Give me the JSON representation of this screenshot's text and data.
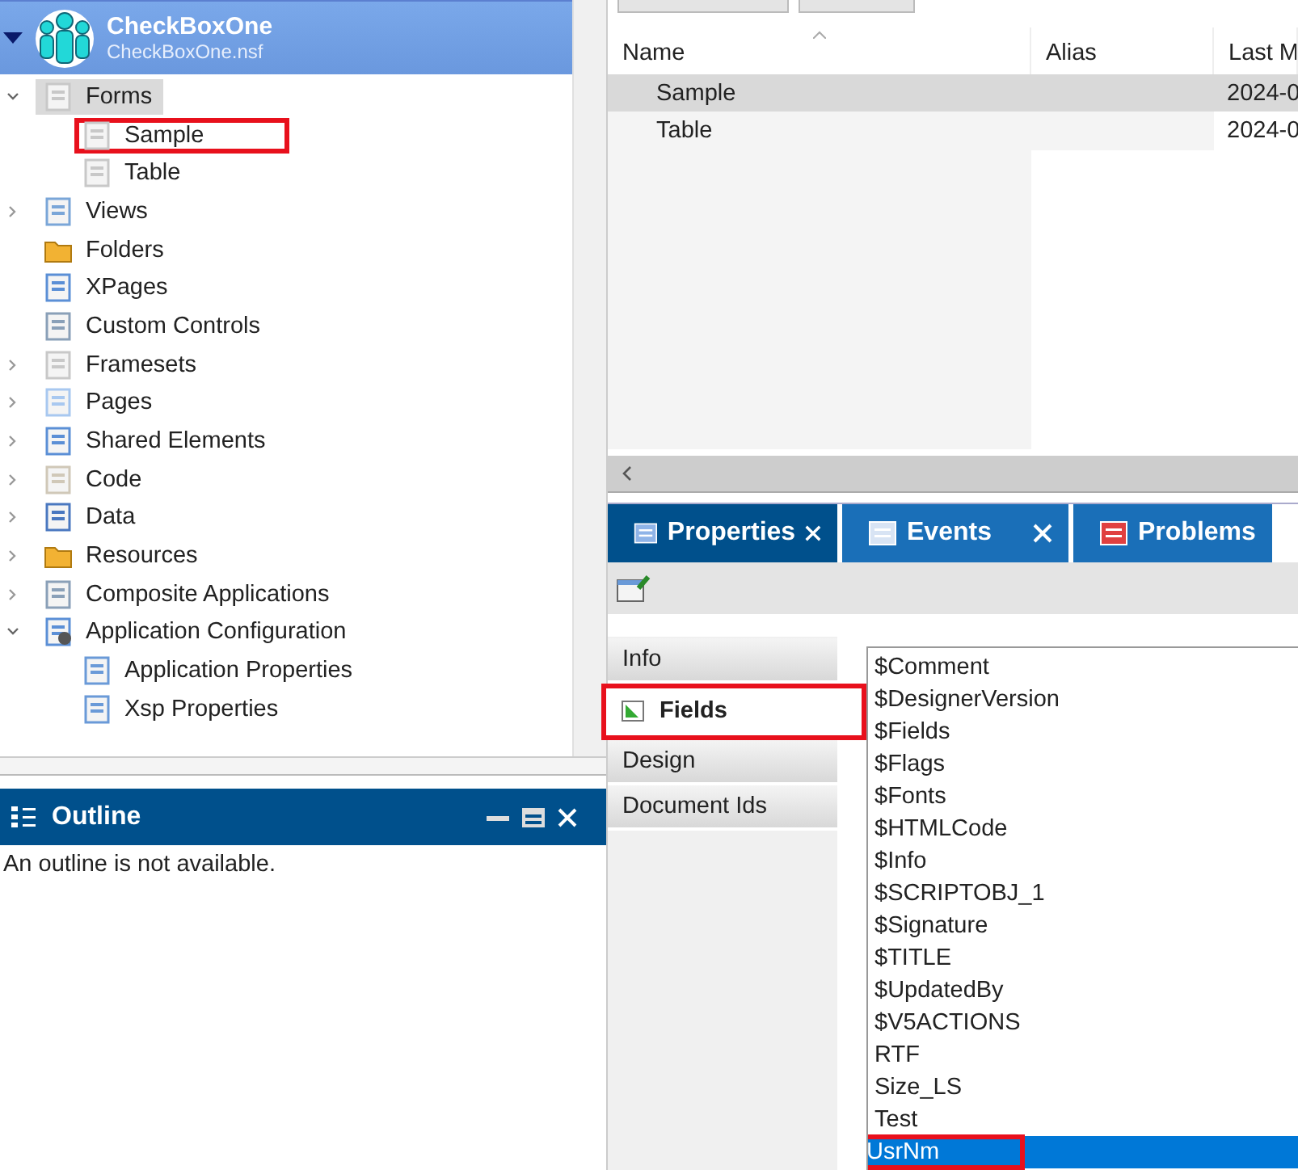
{
  "app": {
    "title": "CheckBoxOne",
    "file": "CheckBoxOne.nsf",
    "expanded": true
  },
  "tree": [
    {
      "label": "Forms",
      "kind": "form",
      "expanded": true,
      "selected": true,
      "children": [
        {
          "label": "Sample",
          "kind": "form",
          "selected": false,
          "annotated": true
        },
        {
          "label": "Table",
          "kind": "form",
          "selected": false,
          "annotated": false
        }
      ]
    },
    {
      "label": "Views",
      "kind": "view",
      "expanded": false,
      "selected": false
    },
    {
      "label": "Folders",
      "kind": "folder",
      "selected": false
    },
    {
      "label": "XPages",
      "kind": "xpage",
      "selected": false
    },
    {
      "label": "Custom Controls",
      "kind": "control",
      "selected": false
    },
    {
      "label": "Framesets",
      "kind": "frameset",
      "expanded": false,
      "selected": false
    },
    {
      "label": "Pages",
      "kind": "page",
      "expanded": false,
      "selected": false
    },
    {
      "label": "Shared Elements",
      "kind": "shared",
      "expanded": false,
      "selected": false
    },
    {
      "label": "Code",
      "kind": "code",
      "expanded": false,
      "selected": false
    },
    {
      "label": "Data",
      "kind": "data",
      "expanded": false,
      "selected": false
    },
    {
      "label": "Resources",
      "kind": "resources",
      "expanded": false,
      "selected": false
    },
    {
      "label": "Composite Applications",
      "kind": "composite",
      "expanded": false,
      "selected": false
    },
    {
      "label": "Application Configuration",
      "kind": "config",
      "expanded": true,
      "selected": false,
      "children": [
        {
          "label": "Application Properties",
          "kind": "props",
          "selected": false
        },
        {
          "label": "Xsp Properties",
          "kind": "props",
          "selected": false
        }
      ]
    }
  ],
  "outline": {
    "title": "Outline",
    "message": "An outline is not available."
  },
  "table": {
    "columns": [
      "Name",
      "Alias",
      "Last M"
    ],
    "rows": [
      {
        "cells": [
          "Sample",
          "",
          "2024-0"
        ],
        "selected": true
      },
      {
        "cells": [
          "Table",
          "",
          "2024-0"
        ],
        "selected": false
      }
    ]
  },
  "tabs": [
    {
      "label": "Properties",
      "kind": "properties",
      "closable": true,
      "selected": true
    },
    {
      "label": "Events",
      "kind": "events",
      "closable": true,
      "selected": false
    },
    {
      "label": "Problems",
      "kind": "problems",
      "closable": false,
      "selected": false
    }
  ],
  "side_tabs": [
    {
      "label": "Info",
      "selected": false,
      "annotated": false
    },
    {
      "label": "Fields",
      "selected": true,
      "annotated": true
    },
    {
      "label": "Design",
      "selected": false,
      "annotated": false
    },
    {
      "label": "Document Ids",
      "selected": false,
      "annotated": false
    }
  ],
  "fields": [
    {
      "label": "$Comment",
      "selected": false,
      "annotated": false
    },
    {
      "label": "$DesignerVersion",
      "selected": false,
      "annotated": false
    },
    {
      "label": "$Fields",
      "selected": false,
      "annotated": false
    },
    {
      "label": "$Flags",
      "selected": false,
      "annotated": false
    },
    {
      "label": "$Fonts",
      "selected": false,
      "annotated": false
    },
    {
      "label": "$HTMLCode",
      "selected": false,
      "annotated": false
    },
    {
      "label": "$Info",
      "selected": false,
      "annotated": false
    },
    {
      "label": "$SCRIPTOBJ_1",
      "selected": false,
      "annotated": false
    },
    {
      "label": "$Signature",
      "selected": false,
      "annotated": false
    },
    {
      "label": "$TITLE",
      "selected": false,
      "annotated": false
    },
    {
      "label": "$UpdatedBy",
      "selected": false,
      "annotated": false
    },
    {
      "label": "$V5ACTIONS",
      "selected": false,
      "annotated": false
    },
    {
      "label": "RTF",
      "selected": false,
      "annotated": false
    },
    {
      "label": "Size_LS",
      "selected": false,
      "annotated": false
    },
    {
      "label": "Test",
      "selected": false,
      "annotated": false
    },
    {
      "label": "UsrNm",
      "selected": true,
      "annotated": true
    }
  ]
}
